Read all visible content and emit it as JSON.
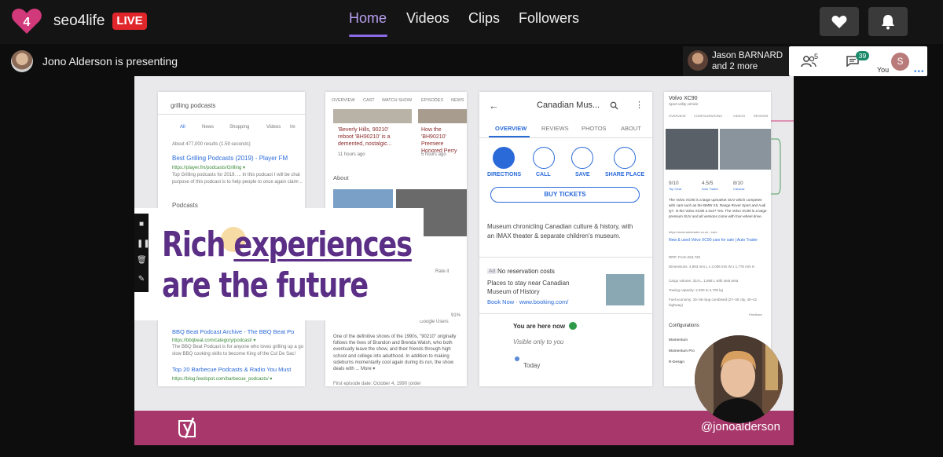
{
  "header": {
    "channel_name": "seo4life",
    "live_badge": "LIVE",
    "nav": [
      {
        "label": "Home",
        "active": true
      },
      {
        "label": "Videos",
        "active": false
      },
      {
        "label": "Clips",
        "active": false
      },
      {
        "label": "Followers",
        "active": false
      }
    ],
    "buttons": {
      "follow_icon": "heart-icon",
      "notify_icon": "bell-icon"
    }
  },
  "presenter": {
    "text": "Jono Alderson is presenting"
  },
  "participants": {
    "name": "Jason BARNARD",
    "more": "and 2 more",
    "viewer_count": "5",
    "chat_count": "39",
    "user_initial": "S",
    "user_label": "You"
  },
  "slide": {
    "title_line1_a": "Rich ",
    "title_line1_b": "experiences",
    "title_line2": "are the future",
    "handle": "@jonoalderson",
    "left_panel": {
      "query": "grilling podcasts",
      "tabs": [
        "All",
        "News",
        "Shopping",
        "Videos",
        "Im"
      ],
      "results_count": "About 477,000 results (1.59 seconds)",
      "result1_title": "Best Grilling Podcasts (2019) - Player FM",
      "result1_url": "https://player.fm/podcasts/Grilling ▾",
      "result1_snippet": "Top Grilling podcasts for 2019. ... In this podcast I will be chat",
      "result1_snippet2": "purpose of this podcast is to help people to once again claim ..",
      "podcasts_label": "Podcasts",
      "result2_title": "BBQ Beat Podcast Archive - The BBQ Beat Po",
      "result2_url": "https://bbqbeat.com/category/podcast/ ▾",
      "result2_snippet": "The BBQ Beat Podcast is for anyone who loves grilling up a go",
      "result2_snippet2": "slow BBQ cooking skills to become King of the Cul De Sac!",
      "result3_title": "Top 20 Barbecue Podcasts & Radio You Must",
      "result3_url": "https://blog.feedspot.com/barbecue_podcasts/ ▾"
    },
    "mid_panel": {
      "tabs": [
        "OVERVIEW",
        "CAST",
        "WATCH SHOW",
        "EPISODES",
        "NEWS"
      ],
      "card1": "'Beverly Hills, 90210' reboot 'BH90210' is a demented, nostalgic...",
      "card1_time": "11 hours ago",
      "card2": "How the 'BH90210' Premiere Honored Perry",
      "card2_time": "5 hours ago",
      "about": "About",
      "rate": "Rate it",
      "users": "Google Users",
      "percent": "91%",
      "description": "One of the definitive shows of the 1990s, \"90210\" originally follows the lives of Brandon and Brenda Walsh, who both eventually leave the show, and their friends through high school and college into adulthood. In addition to making sideburns momentarily cool again during its run, the show deals with ... More ▾",
      "first_episode": "First episode date: October 4, 1990 (order"
    },
    "map_panel": {
      "title": "Canadian Mus...",
      "tabs": [
        "OVERVIEW",
        "REVIEWS",
        "PHOTOS",
        "ABOUT"
      ],
      "actions": [
        "DIRECTIONS",
        "CALL",
        "SAVE",
        "SHARE PLACE"
      ],
      "buy": "BUY TICKETS",
      "desc": "Museum chronicling Canadian culture & history, with an IMAX theater & separate children's museum.",
      "ad_label": "Ad",
      "ad_title": "No reservation costs",
      "ad_text": "Places to stay near Canadian Museum of History",
      "ad_link": "Book Now · www.booking.com/",
      "here": "You are here now",
      "visible": "Visible only to you",
      "today": "Today"
    },
    "car_panel": {
      "title": "Volvo XC90",
      "subtitle": "Sport utility vehicle",
      "tabs": [
        "OVERVIEW",
        "CONFIGURATIONS",
        "VIDEOS",
        "REVIEWS"
      ],
      "ratings": [
        {
          "score": "9/10",
          "source": "Top Gear"
        },
        {
          "score": "4.5/5",
          "source": "Auto Trader"
        },
        {
          "score": "8/10",
          "source": "Carwow"
        }
      ],
      "desc": "The Volvo XC90 is a large upmarket SUV which competes with cars such as the BMW X5, Range Rover Sport and Audi Q7. Is the Volvo XC90 a 4x4? Yes. The Volvo XC90 is a large premium SUV and all versions come with four-wheel drive.",
      "link_url": "https://www.autotrader.co.uk › cars",
      "link_title": "New & used Volvo XC90 cars for sale | Auto Trader",
      "specs": [
        "RRP: From £53,725",
        "Dimensions: 4,953 mm L x 2,008 mm W x 1,776 mm H",
        "Cargo volume: 314 L, 1,868 L with seat area",
        "Towing capacity: 2,400 to 2,700 kg",
        "Fuel economy: 34–36 mpg combined (27–30 city, 40–42 highway)"
      ],
      "feedback": "Feedback",
      "config_label": "Configurations",
      "configs": [
        "Momentum",
        "Momentum Pro",
        "R-Design"
      ]
    }
  }
}
